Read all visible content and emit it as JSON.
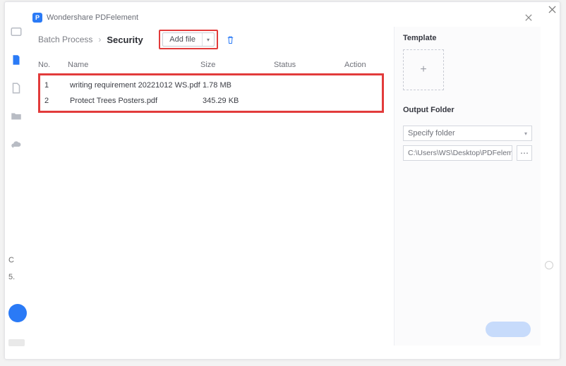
{
  "app": {
    "title": "Wondershare PDFelement"
  },
  "left_panel_fragments": {
    "c": "C",
    "n": "5."
  },
  "breadcrumb": {
    "root": "Batch Process",
    "current": "Security"
  },
  "toolbar": {
    "add_file": "Add file"
  },
  "table": {
    "headers": {
      "no": "No.",
      "name": "Name",
      "size": "Size",
      "status": "Status",
      "action": "Action"
    },
    "rows": [
      {
        "no": "1",
        "name": "writing requirement 20221012 WS.pdf",
        "size": "1.78 MB"
      },
      {
        "no": "2",
        "name": "Protect Trees Posters.pdf",
        "size": "345.29 KB"
      }
    ]
  },
  "side": {
    "template_title": "Template",
    "output_title": "Output Folder",
    "specify": "Specify folder",
    "path": "C:\\Users\\WS\\Desktop\\PDFelement\\Sec"
  }
}
